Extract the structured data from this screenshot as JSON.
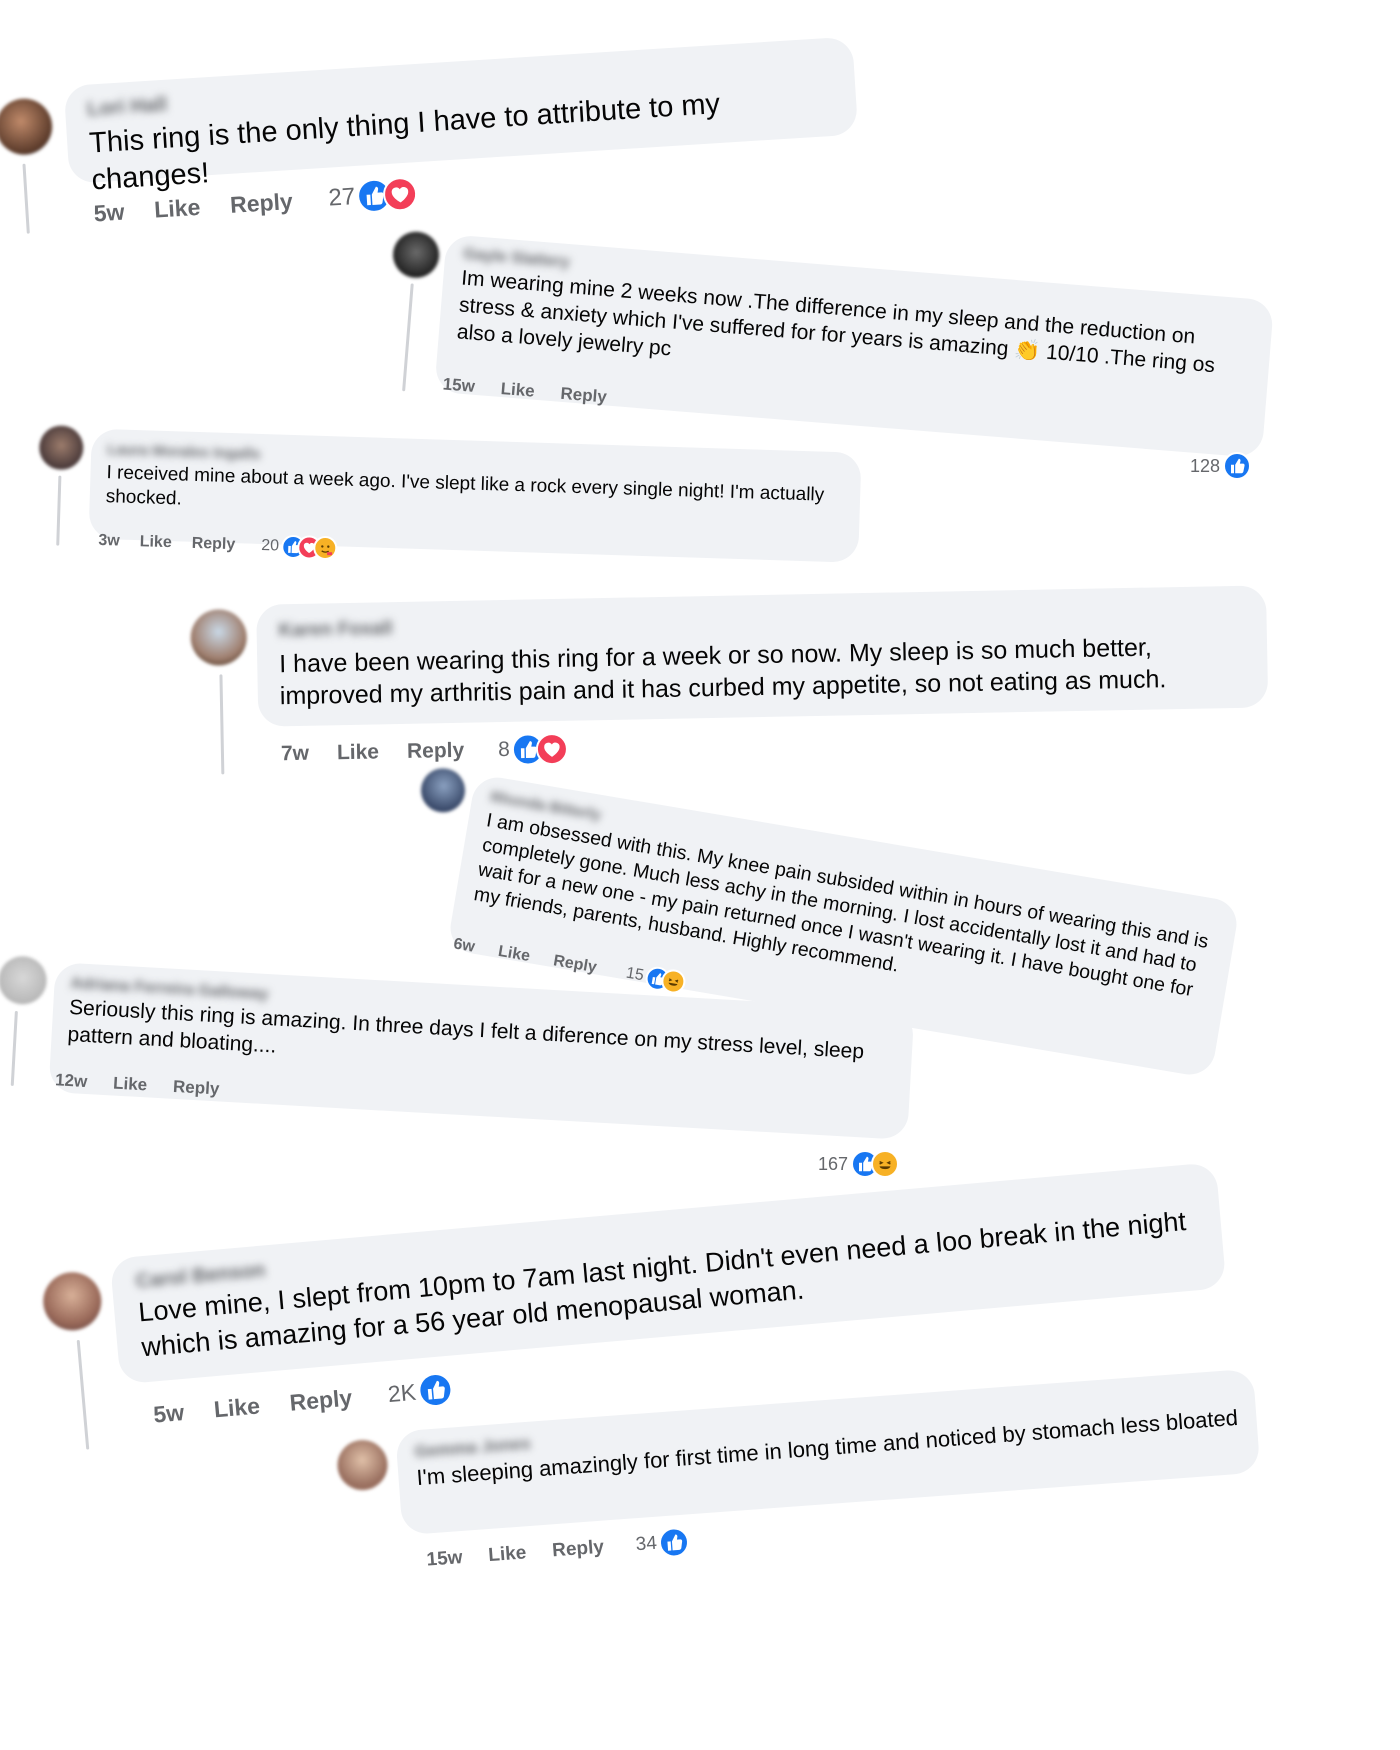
{
  "colors": {
    "bubble": "#f0f2f5",
    "like_blue": "#1877f2",
    "love_red": "#f33e58",
    "haha_yellow": "#f7b125",
    "meta_gray": "#65676b"
  },
  "comments": [
    {
      "author": "Lori Hall",
      "text": "This ring is the only thing I have to attribute to my changes!",
      "time": "5w",
      "like": "Like",
      "reply": "Reply",
      "count": "27",
      "reactions": [
        "like-icon",
        "love-icon"
      ]
    },
    {
      "author": "Gayle Slattery",
      "text": "Im wearing mine 2 weeks now .The difference in my sleep and the reduction on stress & anxiety which I've suffered for for years is amazing 👏 10/10 .The ring os also a lovely jewelry pc",
      "time": "15w",
      "like": "Like",
      "reply": "Reply",
      "count": "128",
      "reactions": [
        "like-icon"
      ]
    },
    {
      "author": "Laura Morales Ingalls",
      "text": "I received mine about a week ago. I've slept like a rock every single night! I'm actually shocked.",
      "time": "3w",
      "like": "Like",
      "reply": "Reply",
      "count": "20",
      "reactions": [
        "like-icon",
        "love-icon",
        "care-icon"
      ]
    },
    {
      "author": "Karen Foxall",
      "text": "I have been wearing this ring for a week or so now. My sleep is so much better, improved my arthritis pain and it has curbed my appetite, so not eating as much.",
      "time": "7w",
      "like": "Like",
      "reply": "Reply",
      "count": "8",
      "reactions": [
        "like-icon",
        "love-icon"
      ]
    },
    {
      "author": "Rhonda Bitterly",
      "text": "I am obsessed with this. My knee pain subsided within in hours of wearing this and is completely gone. Much less achy in the morning. I lost accidentally lost it and had to wait for a new one - my pain returned once I wasn't wearing it. I have bought one for my friends, parents, husband. Highly recommend.",
      "time": "6w",
      "like": "Like",
      "reply": "Reply",
      "count": "15",
      "reactions": [
        "like-icon",
        "haha-icon"
      ]
    },
    {
      "author": "Adriana Ferreira Galloway",
      "text": "Seriously this ring is amazing. In three days I felt a diference on my stress level, sleep pattern and bloating....",
      "time": "12w",
      "like": "Like",
      "reply": "Reply",
      "count": "167",
      "reactions": [
        "like-icon",
        "haha-icon"
      ]
    },
    {
      "author": "Carol Benson",
      "text": "Love mine, I slept from 10pm to 7am last night. Didn't even need a loo break in the night which is amazing for a 56 year old menopausal woman.",
      "time": "5w",
      "like": "Like",
      "reply": "Reply",
      "count": "2K",
      "reactions": [
        "like-icon"
      ]
    },
    {
      "author": "Gemma Jones",
      "text": "I'm sleeping amazingly for first time in long time and noticed by stomach less bloated",
      "time": "15w",
      "like": "Like",
      "reply": "Reply",
      "count": "34",
      "reactions": [
        "like-icon"
      ]
    }
  ]
}
